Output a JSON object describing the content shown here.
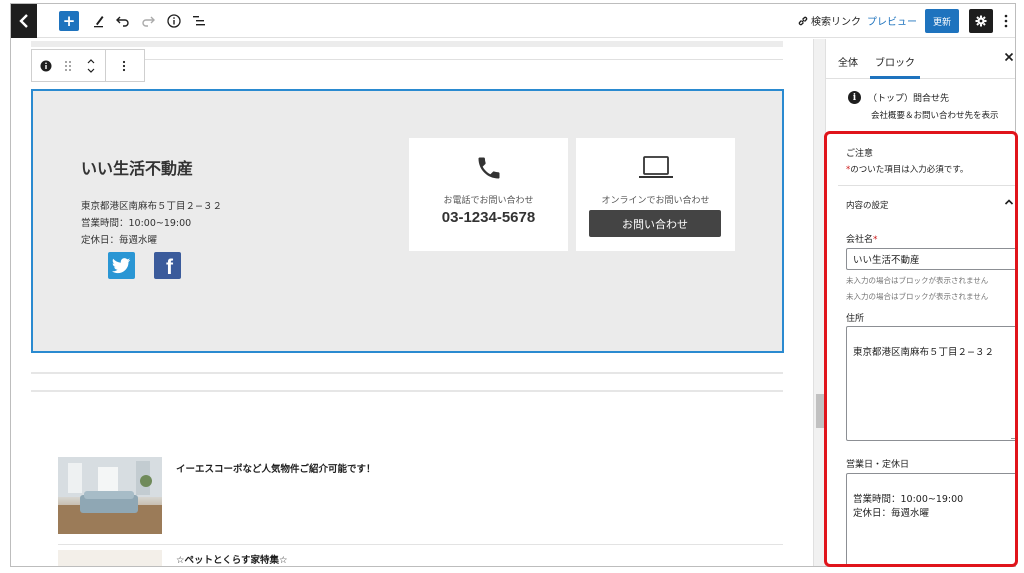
{
  "topbar": {
    "add_label": "+",
    "search_link": "検索リンク",
    "preview": "プレビュー",
    "update": "更新"
  },
  "block": {
    "company_name": "いい生活不動産",
    "address": "東京都港区南麻布５丁目２−３２",
    "hours": "営業時間：10:00~19:00",
    "holiday": "定休日：毎週水曜",
    "phone_label": "お電話でお問い合わせ",
    "phone_number": "03-1234-5678",
    "online_label": "オンラインでお問い合わせ",
    "contact_button": "お問い合わせ",
    "facebook_letter": "f"
  },
  "posts": [
    {
      "title": "イーエスコーポなど人気物件ご紹介可能です！"
    },
    {
      "title": "☆ペットとくらす家特集☆"
    }
  ],
  "sidebar": {
    "tab_document": "全体",
    "tab_block": "ブロック",
    "block_name": "（トップ）問合せ先",
    "block_description": "会社概要＆お問い合わせ先を表示",
    "caution_title": "ご注意",
    "caution_mark": "*",
    "caution_text": "のついた項目は入力必須です。",
    "section_title": "内容の設定",
    "fields": {
      "company_label": "会社名",
      "required_mark": "*",
      "company_value": "いい生活不動産",
      "help_1": "未入力の場合はブロックが表示されません",
      "help_2": "未入力の場合はブロックが表示されません",
      "address_label": "住所",
      "address_value": "東京都港区南麻布５丁目２−３２",
      "hours_label": "営業日・定休日",
      "hours_value": "営業時間：10:00~19:00\n定休日：毎週水曜"
    }
  },
  "colors": {
    "accent": "#1e73be",
    "highlight": "#e0141b",
    "twitter": "#2a96d4",
    "facebook": "#3b5b9b"
  }
}
